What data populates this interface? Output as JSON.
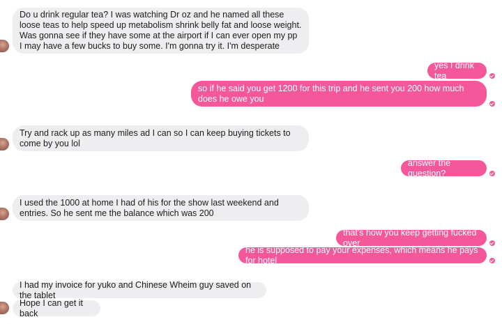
{
  "colors": {
    "incoming_bubble": "#eeedf0",
    "outgoing_bubble": "#f4589a",
    "outgoing_text": "#ffffff",
    "incoming_text": "#1c1c1c"
  },
  "messages": [
    {
      "direction": "incoming",
      "text": "Do u drink regular tea? I was watching Dr oz and he named all these loose teas to help speed up metabolism shrink belly fat and loose weight. Was gonna see if they have some at the airport if I can ever open my pp I may have a few bucks to buy some. I'm gonna try it. I'm desperate"
    },
    {
      "direction": "outgoing",
      "text": "yes I drink tea"
    },
    {
      "direction": "outgoing",
      "text": "so if he said you get 1200 for this trip and he sent you 200 how much does he owe you"
    },
    {
      "direction": "incoming",
      "text": "Try and rack up as many miles ad I can so I can keep buying tickets to come by you lol"
    },
    {
      "direction": "outgoing",
      "text": "answer the question?"
    },
    {
      "direction": "incoming",
      "text": "I used the 1000 at home I had of his for the show last weekend and entries. So he sent me the balance which was 200"
    },
    {
      "direction": "outgoing",
      "text": "that's how you keep getting fucked over"
    },
    {
      "direction": "outgoing",
      "text": "he is supposed to pay your expenses, which means he pays for hotel"
    },
    {
      "direction": "incoming",
      "text": "I had my invoice for yuko and Chinese Wheim guy saved on the tablet"
    },
    {
      "direction": "incoming",
      "text": "Hope I can get it back"
    }
  ]
}
